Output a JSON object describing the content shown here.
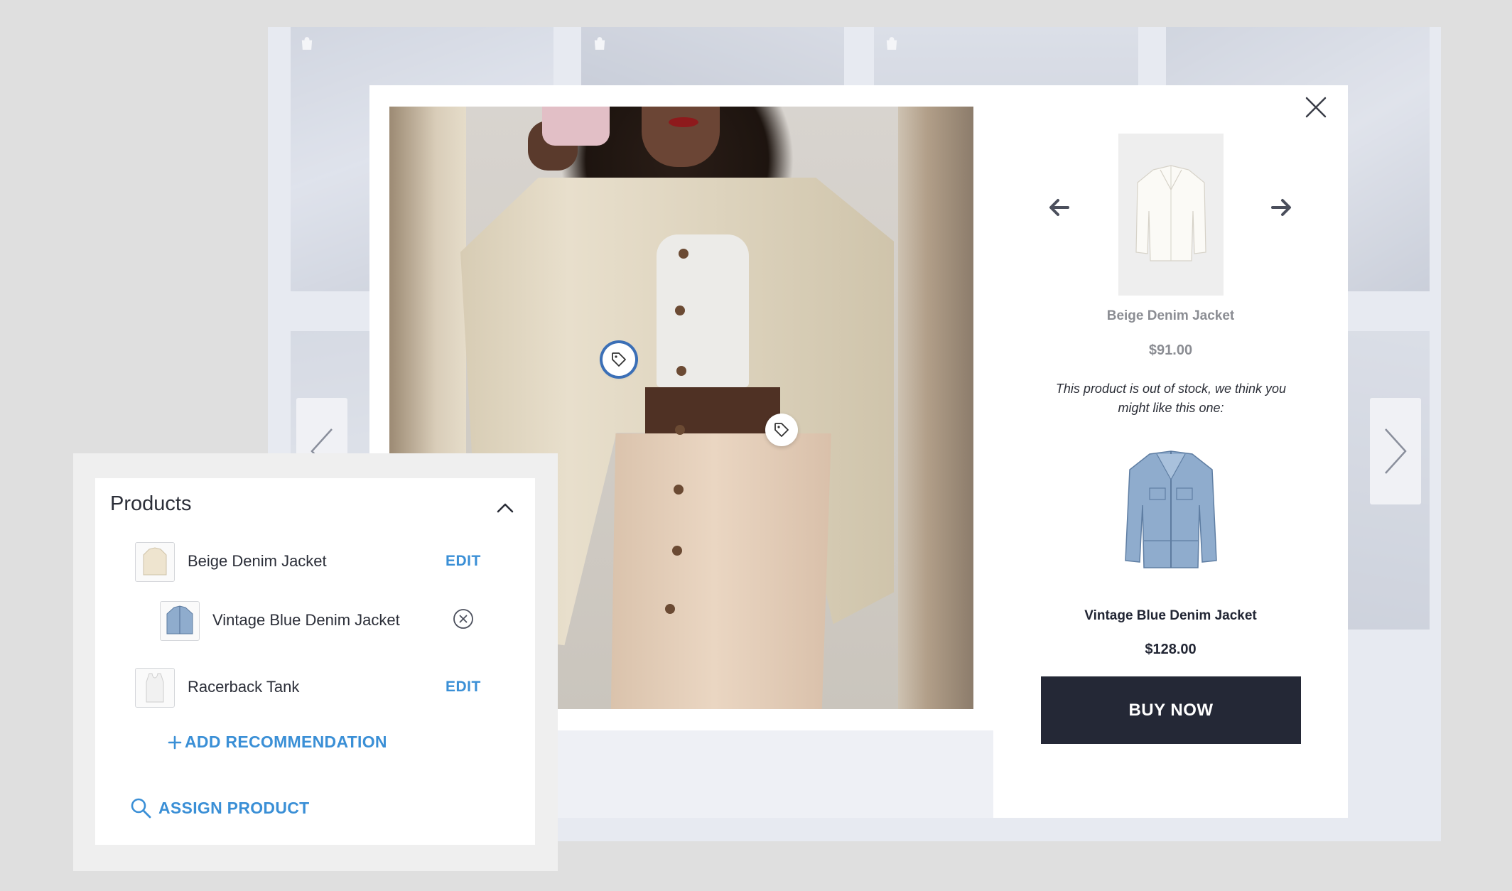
{
  "lightbox": {
    "product": {
      "name": "Beige Denim Jacket",
      "price": "$91.00",
      "out_of_stock_message": "This product is out of stock, we think you might like this one:"
    },
    "recommendation": {
      "name": "Vintage Blue Denim Jacket",
      "price": "$128.00"
    },
    "buy_label": "BUY NOW",
    "hotspot_1": "tag-icon",
    "hotspot_2": "tag-icon"
  },
  "panel": {
    "title": "Products",
    "items": [
      {
        "label": "Beige Denim Jacket",
        "action": "EDIT"
      },
      {
        "label": "Vintage Blue Denim Jacket",
        "action": "remove-icon"
      },
      {
        "label": "Racerback Tank",
        "action": "EDIT"
      }
    ],
    "add_recommendation": "ADD RECOMMENDATION",
    "assign_product": "ASSIGN PRODUCT"
  },
  "colors": {
    "accent_blue": "#3a8fd6",
    "button_dark": "#242836",
    "active_hotspot": "#3b6fb6"
  }
}
